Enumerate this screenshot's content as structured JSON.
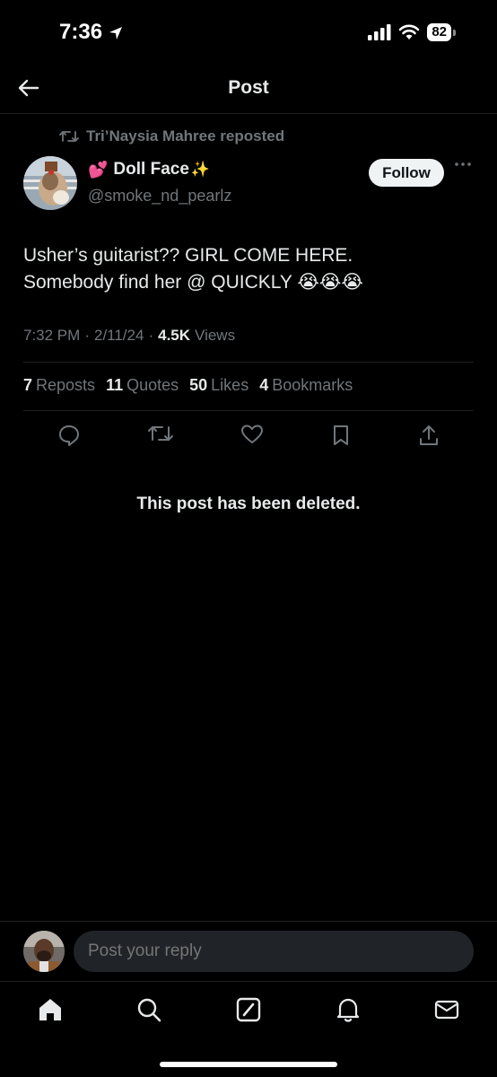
{
  "status_bar": {
    "time": "7:36",
    "battery": "82"
  },
  "header": {
    "title": "Post"
  },
  "repost": {
    "text": "Tri’Naysia Mahree reposted"
  },
  "author": {
    "name": "Doll Face",
    "name_prefix_emoji": "💕",
    "name_suffix_emoji": "✨",
    "handle": "@smoke_nd_pearlz",
    "follow_label": "Follow"
  },
  "post": {
    "line1": "Usher’s guitarist?? GIRL COME HERE.",
    "line2": "Somebody find her @ QUICKLY 😭😭😭",
    "time": "7:32 PM",
    "date": "2/11/24",
    "views_count": "4.5K",
    "views_label": "Views"
  },
  "stats": {
    "reposts_count": "7",
    "reposts_label": "Reposts",
    "quotes_count": "11",
    "quotes_label": "Quotes",
    "likes_count": "50",
    "likes_label": "Likes",
    "bookmarks_count": "4",
    "bookmarks_label": "Bookmarks"
  },
  "deleted_notice": "This post has been deleted.",
  "reply": {
    "placeholder": "Post your reply"
  },
  "icons": [
    "back-arrow-icon",
    "repost-icon",
    "more-icon",
    "reply-icon",
    "retweet-icon",
    "heart-icon",
    "bookmark-icon",
    "share-icon",
    "home-icon",
    "search-icon",
    "grok-icon",
    "bell-icon",
    "mail-icon"
  ],
  "colors": {
    "background": "#000000",
    "text": "#e7e9ea",
    "muted": "#71767b",
    "follow_bg": "#eff3f4"
  }
}
